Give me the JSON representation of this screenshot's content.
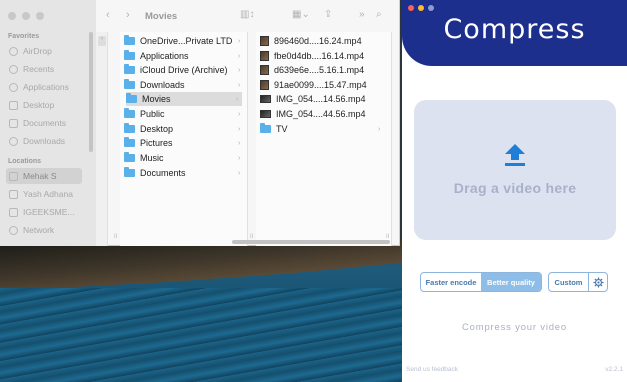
{
  "finder": {
    "window_title": "Movies",
    "sidebar": {
      "favorites_header": "Favorites",
      "favorites": [
        {
          "label": "AirDrop",
          "icon": "airdrop-icon"
        },
        {
          "label": "Recents",
          "icon": "clock-icon"
        },
        {
          "label": "Applications",
          "icon": "applications-icon"
        },
        {
          "label": "Desktop",
          "icon": "desktop-icon"
        },
        {
          "label": "Documents",
          "icon": "document-icon"
        },
        {
          "label": "Downloads",
          "icon": "download-icon"
        }
      ],
      "locations_header": "Locations",
      "locations": [
        {
          "label": "Mehak S",
          "icon": "laptop-icon",
          "selected": true
        },
        {
          "label": "Yash Adhana",
          "icon": "laptop-icon"
        },
        {
          "label": "IGEEKSME...",
          "icon": "display-icon"
        },
        {
          "label": "Network",
          "icon": "globe-icon"
        }
      ]
    },
    "column1": [
      {
        "label": "OneDrive...Private LTD",
        "has_children": true
      },
      {
        "label": "Applications",
        "has_children": true
      },
      {
        "label": "iCloud Drive (Archive)",
        "has_children": true
      },
      {
        "label": "Downloads",
        "has_children": true
      },
      {
        "label": "Movies",
        "has_children": true,
        "selected": true
      },
      {
        "label": "Public",
        "has_children": true
      },
      {
        "label": "Desktop",
        "has_children": true
      },
      {
        "label": "Pictures",
        "has_children": true
      },
      {
        "label": "Music",
        "has_children": true
      },
      {
        "label": "Documents",
        "has_children": true
      }
    ],
    "column2": [
      {
        "label": "896460d....16.24.mp4",
        "kind": "video"
      },
      {
        "label": "fbe0d4db....16.14.mp4",
        "kind": "video"
      },
      {
        "label": "d639e6e....5.16.1.mp4",
        "kind": "video"
      },
      {
        "label": "91ae0099....15.47.mp4",
        "kind": "video"
      },
      {
        "label": "IMG_054....14.56.mp4",
        "kind": "video-wide"
      },
      {
        "label": "IMG_054....44.56.mp4",
        "kind": "video-wide"
      },
      {
        "label": "TV",
        "kind": "folder",
        "has_children": true
      }
    ]
  },
  "compress": {
    "title": "Compress",
    "drop_label": "Drag a video here",
    "options": {
      "faster": "Faster encode",
      "better": "Better quality",
      "selected": "better",
      "custom": "Custom"
    },
    "footer_title": "Compress your video",
    "feedback": "Send us feedback",
    "version": "v2.2.1",
    "colors": {
      "header": "#1c2f8d",
      "dropzone": "#dde2f0",
      "accent": "#8ebde8"
    }
  }
}
